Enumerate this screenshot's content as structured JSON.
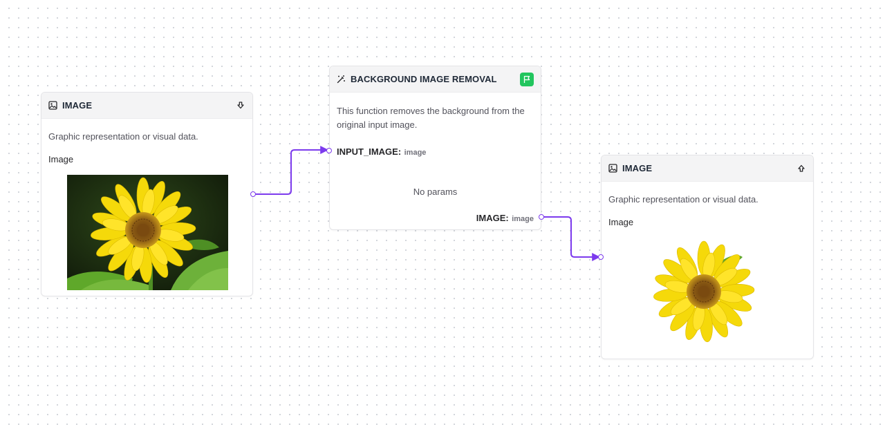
{
  "nodes": {
    "input_image": {
      "title": "IMAGE",
      "icon": "image-icon",
      "pin_icon": "arrow-down-icon",
      "description": "Graphic representation or visual data.",
      "field_label": "Image"
    },
    "bg_removal": {
      "title": "BACKGROUND IMAGE REMOVAL",
      "icon": "magic-wand-icon",
      "action_icon": "flag-icon",
      "description": "This function removes the background from the original input image.",
      "input_port": {
        "label": "INPUT_IMAGE:",
        "type": "image"
      },
      "params_text": "No params",
      "output_port": {
        "label": "IMAGE:",
        "type": "image"
      }
    },
    "output_image": {
      "title": "IMAGE",
      "icon": "image-icon",
      "pin_icon": "arrow-up-icon",
      "description": "Graphic representation or visual data.",
      "field_label": "Image"
    }
  },
  "colors": {
    "edge": "#7c3aed",
    "accent_green": "#22c55e",
    "sunflower_petal": "#f5d90a",
    "sunflower_center": "#8a5a14",
    "leaf": "#5fa82a",
    "photo_bg": "#1d2a12"
  }
}
